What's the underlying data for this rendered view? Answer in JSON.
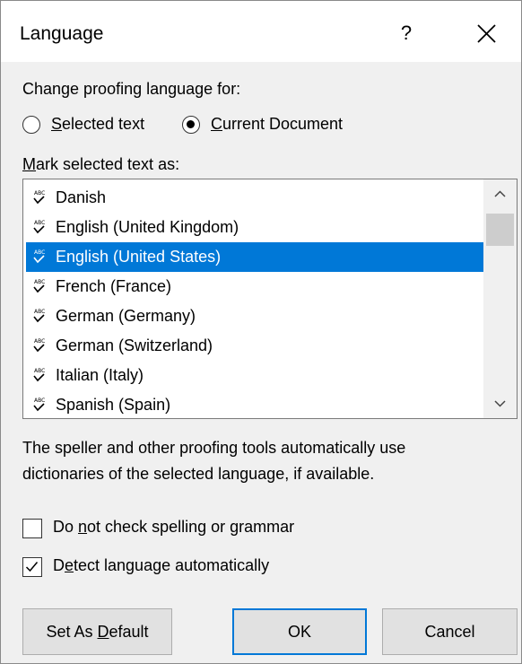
{
  "dialog": {
    "title": "Language",
    "help_label": "?"
  },
  "proofing": {
    "heading": "Change proofing language for:",
    "options": [
      {
        "prefix": "",
        "hotkey": "S",
        "rest": "elected text",
        "selected": false
      },
      {
        "prefix": "",
        "hotkey": "C",
        "rest": "urrent Document",
        "selected": true
      }
    ]
  },
  "mark": {
    "hotkey": "M",
    "rest": "ark selected text as:"
  },
  "languages": {
    "items": [
      "Danish",
      "English (United Kingdom)",
      "English (United States)",
      "French (France)",
      "German (Germany)",
      "German (Switzerland)",
      "Italian (Italy)",
      "Spanish (Spain)"
    ],
    "selected": "English (United States)"
  },
  "description": {
    "line1": "The speller and other proofing tools automatically use",
    "line2": "dictionaries of the selected language, if available."
  },
  "checks": {
    "no_check": {
      "prefix": "Do ",
      "hotkey": "n",
      "rest": "ot check spelling or grammar",
      "checked": false
    },
    "detect": {
      "prefix": "D",
      "hotkey": "e",
      "rest": "tect language automatically",
      "checked": true
    }
  },
  "buttons": {
    "set_default": {
      "prefix": "Set As ",
      "hotkey": "D",
      "rest": "efault"
    },
    "ok": "OK",
    "cancel": "Cancel"
  },
  "colors": {
    "accent": "#0078d7",
    "dialog_bg": "#f0f0f0",
    "button_bg": "#e1e1e1"
  }
}
